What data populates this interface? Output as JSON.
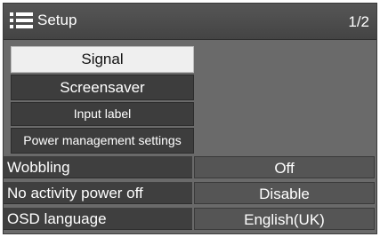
{
  "header": {
    "title": "Setup",
    "page": "1/2",
    "icon": "list-menu-icon"
  },
  "menu": {
    "items": [
      {
        "label": "Signal",
        "selected": true
      },
      {
        "label": "Screensaver",
        "selected": false
      },
      {
        "label": "Input label",
        "selected": false
      },
      {
        "label": "Power management settings",
        "selected": false
      }
    ]
  },
  "settings": [
    {
      "label": "Wobbling",
      "value": "Off"
    },
    {
      "label": "No activity power off",
      "value": "Disable"
    },
    {
      "label": "OSD language",
      "value": "English(UK)"
    }
  ],
  "colors": {
    "panel": "#6a6a6a",
    "button": "#3d3d3d",
    "selected_button": "#efefef",
    "text": "#ffffff"
  }
}
